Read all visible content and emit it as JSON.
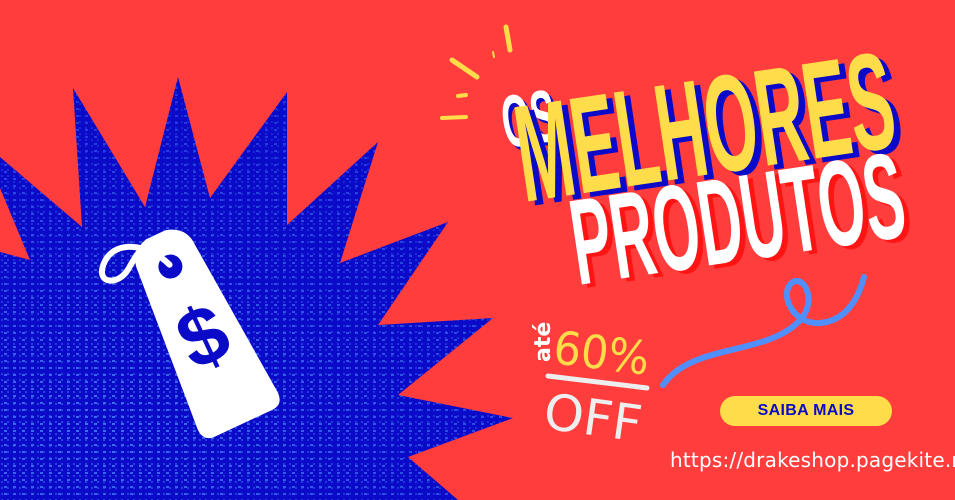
{
  "headline": {
    "word1": "OS",
    "word2": "MELHORES",
    "word3": "PRODUTOS"
  },
  "discount": {
    "prefix": "até",
    "value": "60%",
    "suffix": "OFF"
  },
  "cta": {
    "label": "SAIBA MAIS"
  },
  "url": "https://drakeshop.pagekite.me",
  "icons": {
    "price_tag": "price-tag-dollar-icon",
    "starburst": "starburst-shape",
    "ribbon": "ribbon-squiggle"
  },
  "colors": {
    "background": "#ff3d3d",
    "burst_blue": "#0a0ac8",
    "halftone_blue": "#4f8fff",
    "yellow": "#ffdd4a",
    "white": "#ffffff",
    "ribbon": "#4f8fff"
  }
}
